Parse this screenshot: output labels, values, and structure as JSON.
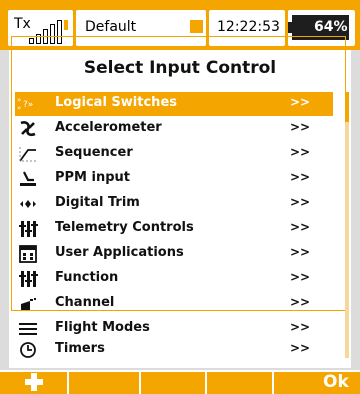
{
  "status": {
    "tx_label": "Tx",
    "model_name": "Default",
    "time": "12:22:53",
    "battery": "64%",
    "battery_level": 0.64
  },
  "page": {
    "title": "Select Input Control"
  },
  "list": {
    "items": [
      {
        "label": "Logical Switches",
        "arrow": ">>",
        "icon": "logical-switches-icon",
        "selected": true
      },
      {
        "label": "Accelerometer",
        "arrow": ">>",
        "icon": "accelerometer-icon"
      },
      {
        "label": "Sequencer",
        "arrow": ">>",
        "icon": "sequencer-icon"
      },
      {
        "label": "PPM input",
        "arrow": ">>",
        "icon": "ppm-input-icon"
      },
      {
        "label": "Digital Trim",
        "arrow": ">>",
        "icon": "digital-trim-icon"
      },
      {
        "label": "Telemetry Controls",
        "arrow": ">>",
        "icon": "telemetry-controls-icon"
      },
      {
        "label": "User Applications",
        "arrow": ">>",
        "icon": "user-applications-icon"
      },
      {
        "label": "Function",
        "arrow": ">>",
        "icon": "function-icon"
      },
      {
        "label": "Channel",
        "arrow": ">>",
        "icon": "channel-icon"
      },
      {
        "label": "Flight Modes",
        "arrow": ">>",
        "icon": "flight-modes-icon"
      },
      {
        "label": "Timers",
        "arrow": ">>",
        "icon": "timers-icon"
      }
    ]
  },
  "bottom_bar": {
    "add_icon": "plus-icon",
    "ok_label": "Ok"
  },
  "colors": {
    "accent": "#f5a500",
    "background": "#ffffff",
    "text": "#111111"
  }
}
